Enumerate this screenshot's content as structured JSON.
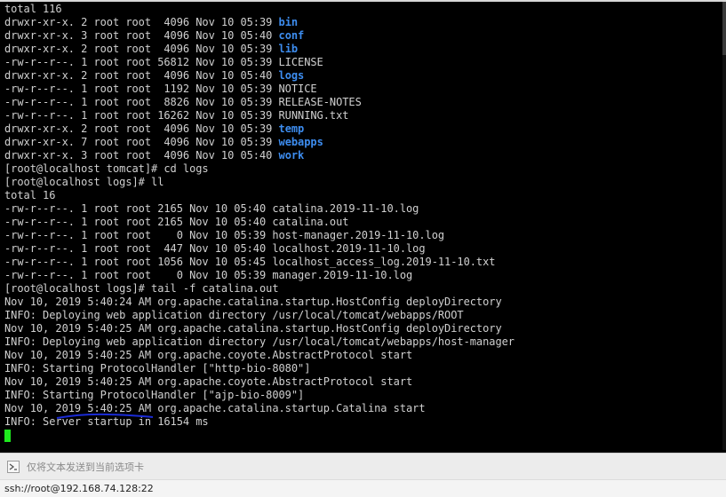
{
  "terminal": {
    "lines": [
      {
        "text": "total 116"
      },
      {
        "prefix": "drwxr-xr-x. 2 root root  4096 Nov 10 05:39 ",
        "name": "bin"
      },
      {
        "prefix": "drwxr-xr-x. 3 root root  4096 Nov 10 05:40 ",
        "name": "conf"
      },
      {
        "prefix": "drwxr-xr-x. 2 root root  4096 Nov 10 05:39 ",
        "name": "lib"
      },
      {
        "text": "-rw-r--r--. 1 root root 56812 Nov 10 05:39 LICENSE"
      },
      {
        "prefix": "drwxr-xr-x. 2 root root  4096 Nov 10 05:40 ",
        "name": "logs"
      },
      {
        "text": "-rw-r--r--. 1 root root  1192 Nov 10 05:39 NOTICE"
      },
      {
        "text": "-rw-r--r--. 1 root root  8826 Nov 10 05:39 RELEASE-NOTES"
      },
      {
        "text": "-rw-r--r--. 1 root root 16262 Nov 10 05:39 RUNNING.txt"
      },
      {
        "prefix": "drwxr-xr-x. 2 root root  4096 Nov 10 05:39 ",
        "name": "temp"
      },
      {
        "prefix": "drwxr-xr-x. 7 root root  4096 Nov 10 05:39 ",
        "name": "webapps"
      },
      {
        "prefix": "drwxr-xr-x. 3 root root  4096 Nov 10 05:40 ",
        "name": "work"
      },
      {
        "text": "[root@localhost tomcat]# cd logs"
      },
      {
        "text": "[root@localhost logs]# ll"
      },
      {
        "text": "total 16"
      },
      {
        "text": "-rw-r--r--. 1 root root 2165 Nov 10 05:40 catalina.2019-11-10.log"
      },
      {
        "text": "-rw-r--r--. 1 root root 2165 Nov 10 05:40 catalina.out"
      },
      {
        "text": "-rw-r--r--. 1 root root    0 Nov 10 05:39 host-manager.2019-11-10.log"
      },
      {
        "text": "-rw-r--r--. 1 root root  447 Nov 10 05:40 localhost.2019-11-10.log"
      },
      {
        "text": "-rw-r--r--. 1 root root 1056 Nov 10 05:45 localhost_access_log.2019-11-10.txt"
      },
      {
        "text": "-rw-r--r--. 1 root root    0 Nov 10 05:39 manager.2019-11-10.log"
      },
      {
        "text": "[root@localhost logs]# tail -f catalina.out"
      },
      {
        "text": "Nov 10, 2019 5:40:24 AM org.apache.catalina.startup.HostConfig deployDirectory"
      },
      {
        "text": "INFO: Deploying web application directory /usr/local/tomcat/webapps/ROOT"
      },
      {
        "text": "Nov 10, 2019 5:40:25 AM org.apache.catalina.startup.HostConfig deployDirectory"
      },
      {
        "text": "INFO: Deploying web application directory /usr/local/tomcat/webapps/host-manager"
      },
      {
        "text": "Nov 10, 2019 5:40:25 AM org.apache.coyote.AbstractProtocol start"
      },
      {
        "text": "INFO: Starting ProtocolHandler [\"http-bio-8080\"]"
      },
      {
        "text": "Nov 10, 2019 5:40:25 AM org.apache.coyote.AbstractProtocol start"
      },
      {
        "text": "INFO: Starting ProtocolHandler [\"ajp-bio-8009\"]"
      },
      {
        "text": "Nov 10, 2019 5:40:25 AM org.apache.catalina.startup.Catalina start"
      },
      {
        "text": "INFO: Server startup in 16154 ms"
      }
    ],
    "dir_color": "#3d8df0",
    "cursor_color": "#1ee81e"
  },
  "sendbar": {
    "placeholder": "仅将文本发送到当前选项卡",
    "icon": "send-input-icon"
  },
  "statusbar": {
    "connection": "ssh://root@192.168.74.128:22"
  }
}
